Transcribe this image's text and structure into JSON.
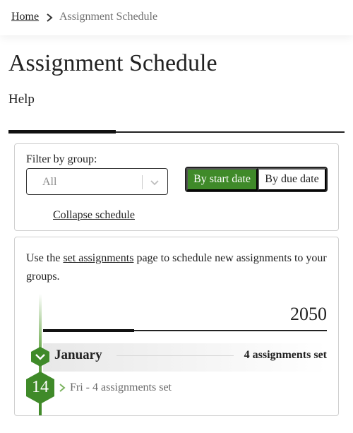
{
  "breadcrumb": {
    "home": "Home",
    "current": "Assignment Schedule"
  },
  "page": {
    "title": "Assignment Schedule",
    "help": "Help"
  },
  "filter": {
    "label": "Filter by group:",
    "selected": "All",
    "sort_by_start": "By start date",
    "sort_by_due": "By due date",
    "active_sort": "By start date",
    "collapse": "Collapse schedule"
  },
  "schedule": {
    "intro_before": "Use the ",
    "intro_link": "set assignments",
    "intro_after": " page to schedule new assignments to your groups.",
    "year": "2050",
    "month": "January",
    "month_count": "4 assignments set",
    "day_number": "14",
    "day_text": "Fri - 4 assignments set"
  },
  "colors": {
    "accent_green": "#3f8a29",
    "text": "#222222",
    "muted": "#707070"
  },
  "icons": [
    "chevron-right-icon",
    "chevron-down-icon",
    "hexagon-icon"
  ]
}
